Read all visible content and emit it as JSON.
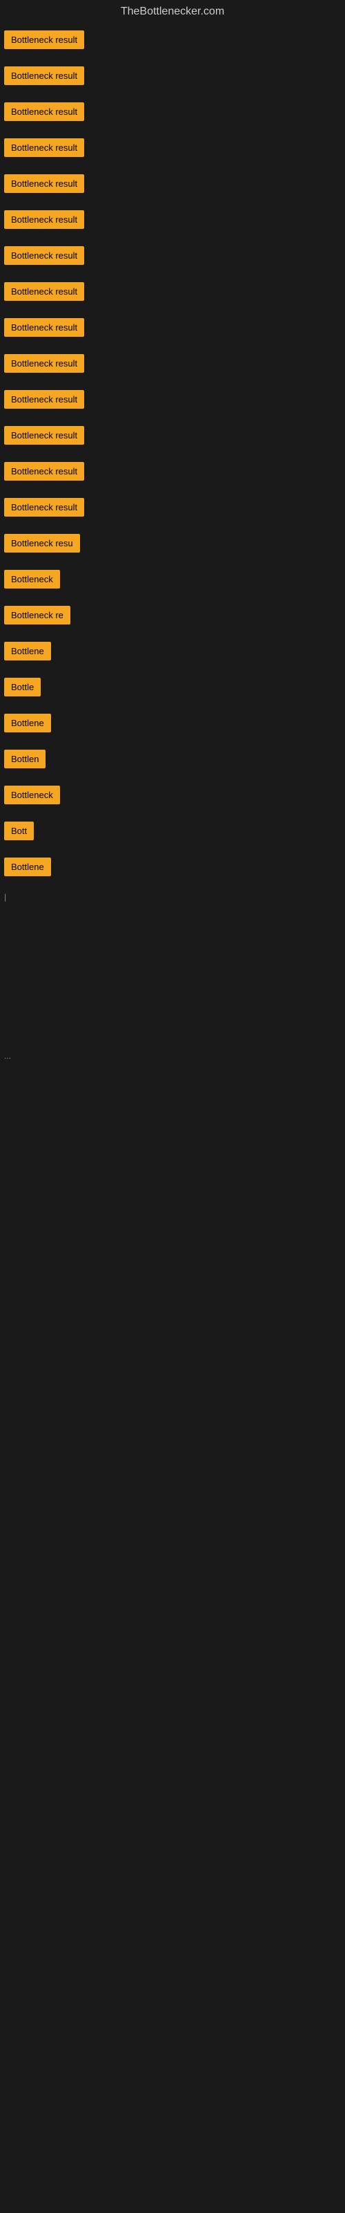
{
  "site": {
    "title": "TheBottlenecker.com"
  },
  "items": [
    {
      "label": "Bottleneck result",
      "width": 130
    },
    {
      "label": "Bottleneck result",
      "width": 130
    },
    {
      "label": "Bottleneck result",
      "width": 130
    },
    {
      "label": "Bottleneck result",
      "width": 130
    },
    {
      "label": "Bottleneck result",
      "width": 130
    },
    {
      "label": "Bottleneck result",
      "width": 130
    },
    {
      "label": "Bottleneck result",
      "width": 130
    },
    {
      "label": "Bottleneck result",
      "width": 130
    },
    {
      "label": "Bottleneck result",
      "width": 130
    },
    {
      "label": "Bottleneck result",
      "width": 130
    },
    {
      "label": "Bottleneck result",
      "width": 130
    },
    {
      "label": "Bottleneck result",
      "width": 130
    },
    {
      "label": "Bottleneck result",
      "width": 130
    },
    {
      "label": "Bottleneck result",
      "width": 130
    },
    {
      "label": "Bottleneck resu",
      "width": 115
    },
    {
      "label": "Bottleneck",
      "width": 82
    },
    {
      "label": "Bottleneck re",
      "width": 100
    },
    {
      "label": "Bottlene",
      "width": 74
    },
    {
      "label": "Bottle",
      "width": 56
    },
    {
      "label": "Bottlene",
      "width": 74
    },
    {
      "label": "Bottlen",
      "width": 68
    },
    {
      "label": "Bottleneck",
      "width": 82
    },
    {
      "label": "Bott",
      "width": 46
    },
    {
      "label": "Bottlene",
      "width": 74
    }
  ],
  "small_marks": [
    {
      "label": "|"
    },
    {
      "label": "..."
    }
  ]
}
